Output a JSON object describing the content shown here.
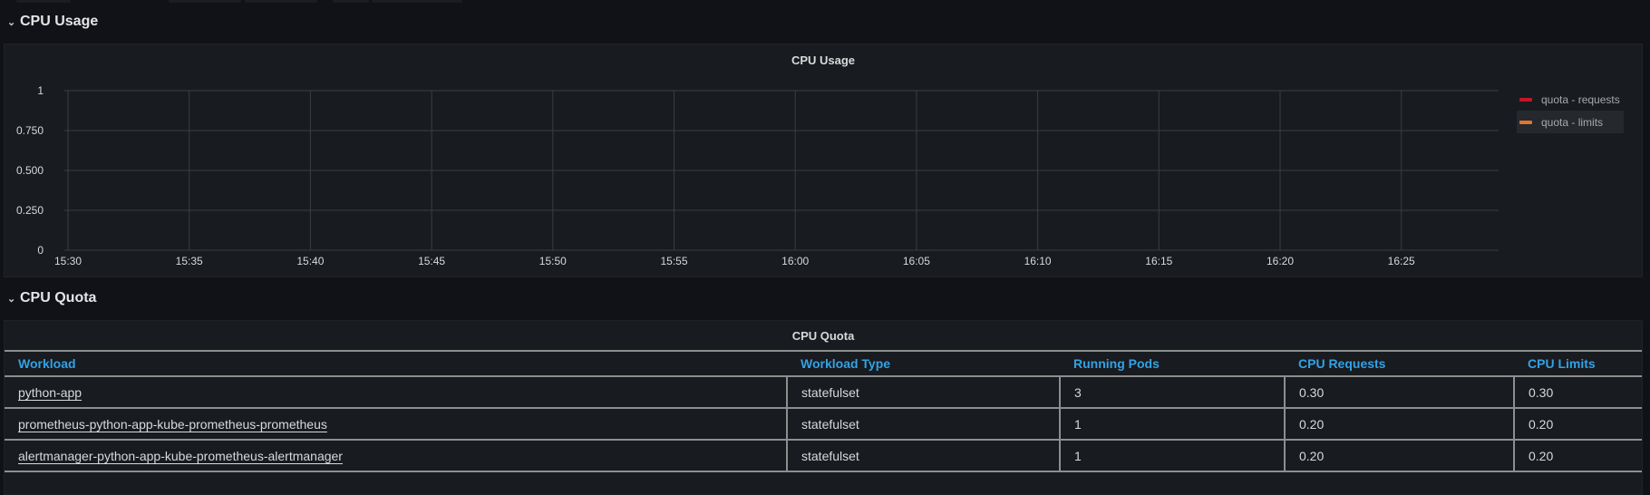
{
  "sections": {
    "usage": {
      "label": "CPU Usage"
    },
    "quota": {
      "label": "CPU Quota"
    }
  },
  "usage_panel": {
    "title": "CPU Usage"
  },
  "quota_panel": {
    "title": "CPU Quota"
  },
  "chart_data": {
    "type": "line",
    "title": "CPU Usage",
    "xlabel": "",
    "ylabel": "",
    "x_ticks": [
      "15:30",
      "15:35",
      "15:40",
      "15:45",
      "15:50",
      "15:55",
      "16:00",
      "16:05",
      "16:10",
      "16:15",
      "16:20",
      "16:25"
    ],
    "y_ticks": [
      "0",
      "0.250",
      "0.500",
      "0.750",
      "1"
    ],
    "ylim": [
      0,
      1
    ],
    "grid": true,
    "legend_position": "right",
    "series": [
      {
        "name": "quota - requests",
        "color": "#c4162a",
        "values": []
      },
      {
        "name": "quota - limits",
        "color": "#e0752d",
        "values": []
      }
    ]
  },
  "table": {
    "columns": [
      "Workload",
      "Workload Type",
      "Running Pods",
      "CPU Requests",
      "CPU Limits"
    ],
    "rows": [
      [
        "python-app",
        "statefulset",
        "3",
        "0.30",
        "0.30"
      ],
      [
        "prometheus-python-app-kube-prometheus-prometheus",
        "statefulset",
        "1",
        "0.20",
        "0.20"
      ],
      [
        "alertmanager-python-app-kube-prometheus-alertmanager",
        "statefulset",
        "1",
        "0.20",
        "0.20"
      ]
    ]
  },
  "colors": {
    "background": "#111217",
    "panel": "#181b1f",
    "header_link": "#33a2e5",
    "grid": "#3a3d42"
  }
}
